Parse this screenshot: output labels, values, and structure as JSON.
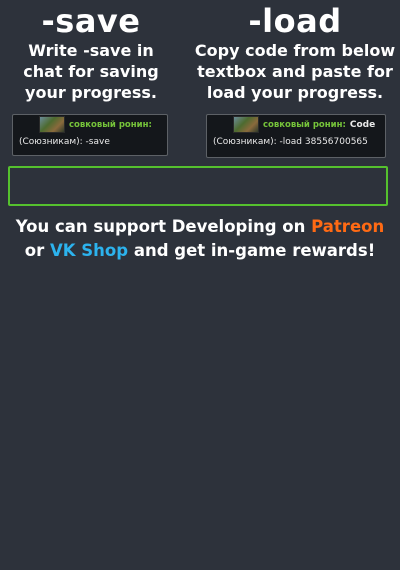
{
  "save": {
    "title": "-save",
    "description": "Write -save in\nchat  for saving\nyour progress.",
    "chat": {
      "name": "совковый ронин:",
      "line": "(Союзникам): -save"
    }
  },
  "load": {
    "title": "-load",
    "description": "Copy code from below\ntextbox and paste for\nload your progress.",
    "chat": {
      "name": "совковый ронин:",
      "code_word": "Code",
      "line": "(Союзникам): -load 38556700565"
    }
  },
  "textbox": {
    "value": ""
  },
  "support": {
    "line1_prefix": "You can support Developing on ",
    "patreon": "Patreon",
    "line2_prefix": "or ",
    "vk_shop": "VK Shop",
    "line2_suffix": " and get in-game rewards!"
  },
  "colors": {
    "background": "#2d323b",
    "accent_green": "#55c12e",
    "patreon": "#ff6a14",
    "vk": "#2cb3ee"
  }
}
